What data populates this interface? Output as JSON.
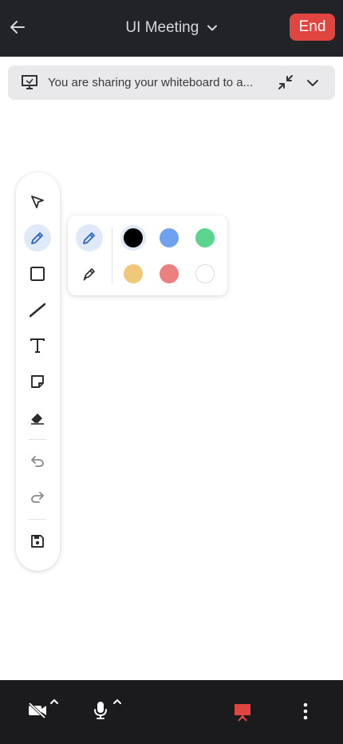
{
  "header": {
    "title": "UI Meeting",
    "end_label": "End"
  },
  "share_banner": {
    "text": "You are sharing your whiteboard to a..."
  },
  "toolbar": {
    "tools": [
      {
        "name": "select",
        "icon": "cursor-icon"
      },
      {
        "name": "pen",
        "icon": "pencil-icon",
        "active": true
      },
      {
        "name": "rectangle",
        "icon": "square-icon"
      },
      {
        "name": "line",
        "icon": "line-icon"
      },
      {
        "name": "text",
        "icon": "text-icon"
      },
      {
        "name": "sticky-note",
        "icon": "sticky-note-icon"
      },
      {
        "name": "eraser",
        "icon": "eraser-icon"
      },
      {
        "name": "undo",
        "icon": "undo-icon"
      },
      {
        "name": "redo",
        "icon": "redo-icon"
      },
      {
        "name": "save",
        "icon": "save-icon"
      }
    ]
  },
  "pen_panel": {
    "modes": [
      "pen",
      "highlighter"
    ],
    "selected_mode": "pen",
    "colors": [
      "#000000",
      "#6ea1ee",
      "#5bd48e",
      "#f0c87a",
      "#ec8080",
      "#ffffff"
    ],
    "selected_color": "#000000"
  },
  "colors": {
    "accent": "#e0453f",
    "active_tool_bg": "#dfe9f8",
    "active_tool_icon": "#2a62c9",
    "share_active": "#e0453f"
  },
  "bottom_bar": {
    "items": [
      "video-off-icon",
      "microphone-icon",
      "present-icon",
      "more-icon"
    ]
  }
}
